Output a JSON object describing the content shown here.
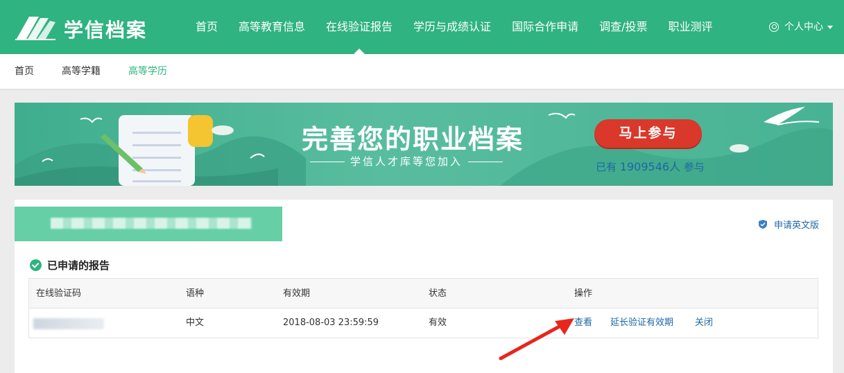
{
  "brand": {
    "logo_text": "学信档案",
    "primary_color": "#2fb380"
  },
  "nav": {
    "items": [
      {
        "label": "首页"
      },
      {
        "label": "高等教育信息"
      },
      {
        "label": "在线验证报告"
      },
      {
        "label": "学历与成绩认证"
      },
      {
        "label": "国际合作申请"
      },
      {
        "label": "调查/投票"
      },
      {
        "label": "职业测评"
      }
    ],
    "active": "在线验证报告",
    "user_label": "个人中心"
  },
  "breadcrumb": {
    "items": [
      {
        "label": "首页"
      },
      {
        "label": "高等学籍"
      },
      {
        "label": "高等学历"
      }
    ],
    "active": "高等学历"
  },
  "banner": {
    "title": "完善您的职业档案",
    "subtitle": "学信人才库等您加入",
    "button_label": "马上参与",
    "joined_prefix": "已有",
    "joined_count": "1909546人",
    "joined_suffix": "参与"
  },
  "panel": {
    "apply_english_label": "申请英文版",
    "section_title": "已申请的报告",
    "table": {
      "headers": [
        "在线验证码",
        "语种",
        "有效期",
        "状态",
        "操作"
      ],
      "rows": [
        {
          "language": "中文",
          "expiry": "2018-08-03 23:59:59",
          "status": "有效",
          "actions": [
            "查看",
            "延长验证有效期",
            "关闭"
          ]
        }
      ]
    }
  }
}
